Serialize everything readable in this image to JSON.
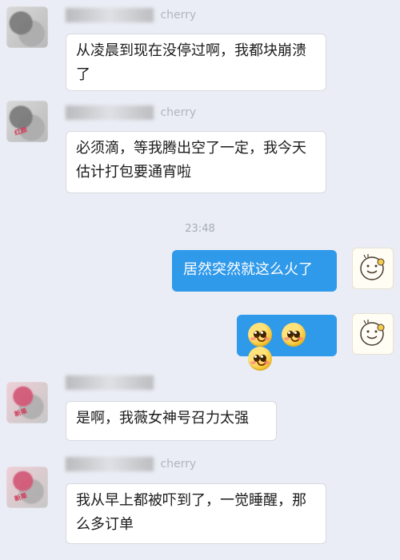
{
  "messages": [
    {
      "side": "left",
      "name": "cherry",
      "text": "从凌晨到现在没停过啊，我都块崩溃了"
    },
    {
      "side": "left",
      "name": "cherry",
      "text": "必须滴，等我腾出空了一定，我今天估计打包要通宵啦"
    },
    {
      "side": "center",
      "timestamp": "23:48"
    },
    {
      "side": "right",
      "text": "居然突然就这么火了"
    },
    {
      "side": "right",
      "emoji_label": "😳😳😳"
    },
    {
      "side": "left",
      "name": "",
      "text": "是啊，我薇女神号召力太强"
    },
    {
      "side": "left",
      "name": "cherry",
      "text": "我从早上都被吓到了，一觉睡醒，那么多订单"
    }
  ],
  "ui": {
    "avatar_tags": [
      "红颜",
      "新果",
      "新果",
      "新果"
    ]
  }
}
